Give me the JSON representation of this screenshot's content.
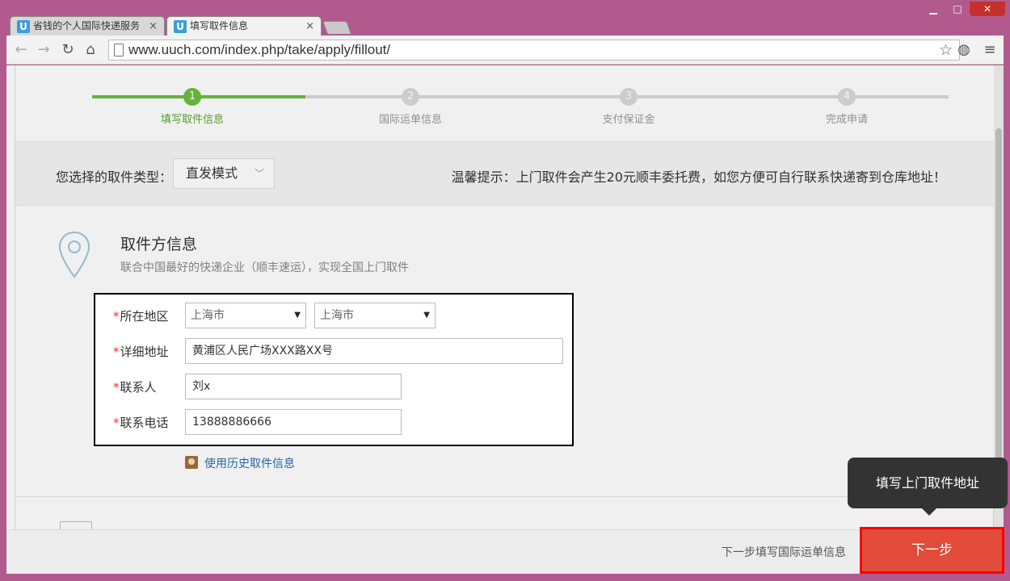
{
  "window": {
    "minimize": "▁",
    "maximize": "□",
    "close": "✕"
  },
  "tabs": [
    {
      "label": "省钱的个人国际快递服务",
      "favicon": "U"
    },
    {
      "label": "填写取件信息",
      "favicon": "U"
    }
  ],
  "toolbar": {
    "back": "←",
    "forward": "→",
    "reload": "↻",
    "home": "⌂",
    "url": "www.uuch.com/index.php/take/apply/fillout/",
    "star": "☆",
    "globe": "◍",
    "menu": "≡"
  },
  "steps": [
    {
      "num": "1",
      "label": "填写取件信息"
    },
    {
      "num": "2",
      "label": "国际运单信息"
    },
    {
      "num": "3",
      "label": "支付保证金"
    },
    {
      "num": "4",
      "label": "完成申请"
    }
  ],
  "type_bar": {
    "label": "您选择的取件类型：",
    "selected": "直发模式",
    "tip": "温馨提示：上门取件会产生20元顺丰委托费，如您方便可自行联系快递寄到仓库地址！"
  },
  "section": {
    "title": "取件方信息",
    "subtitle": "联合中国最好的快递企业（顺丰速运），实现全国上门取件",
    "history_link": "使用历史取件信息"
  },
  "form": {
    "required_mark": "*",
    "region_label": "所在地区",
    "province": "上海市",
    "city": "上海市",
    "select_arrow": "▼",
    "address_label": "详细地址",
    "address_value": "黄浦区人民广场XXX路XX号",
    "contact_label": "联系人",
    "contact_value": "刘x",
    "phone_label": "联系电话",
    "phone_value": "13888886666"
  },
  "footer": {
    "hint": "下一步填写国际运单信息",
    "next_button": "下一步"
  },
  "tooltip": "填写上门取件地址",
  "colors": {
    "accent_green": "#6bbf3c",
    "next_red": "#e34b3a",
    "highlight_red": "#ff0000"
  }
}
